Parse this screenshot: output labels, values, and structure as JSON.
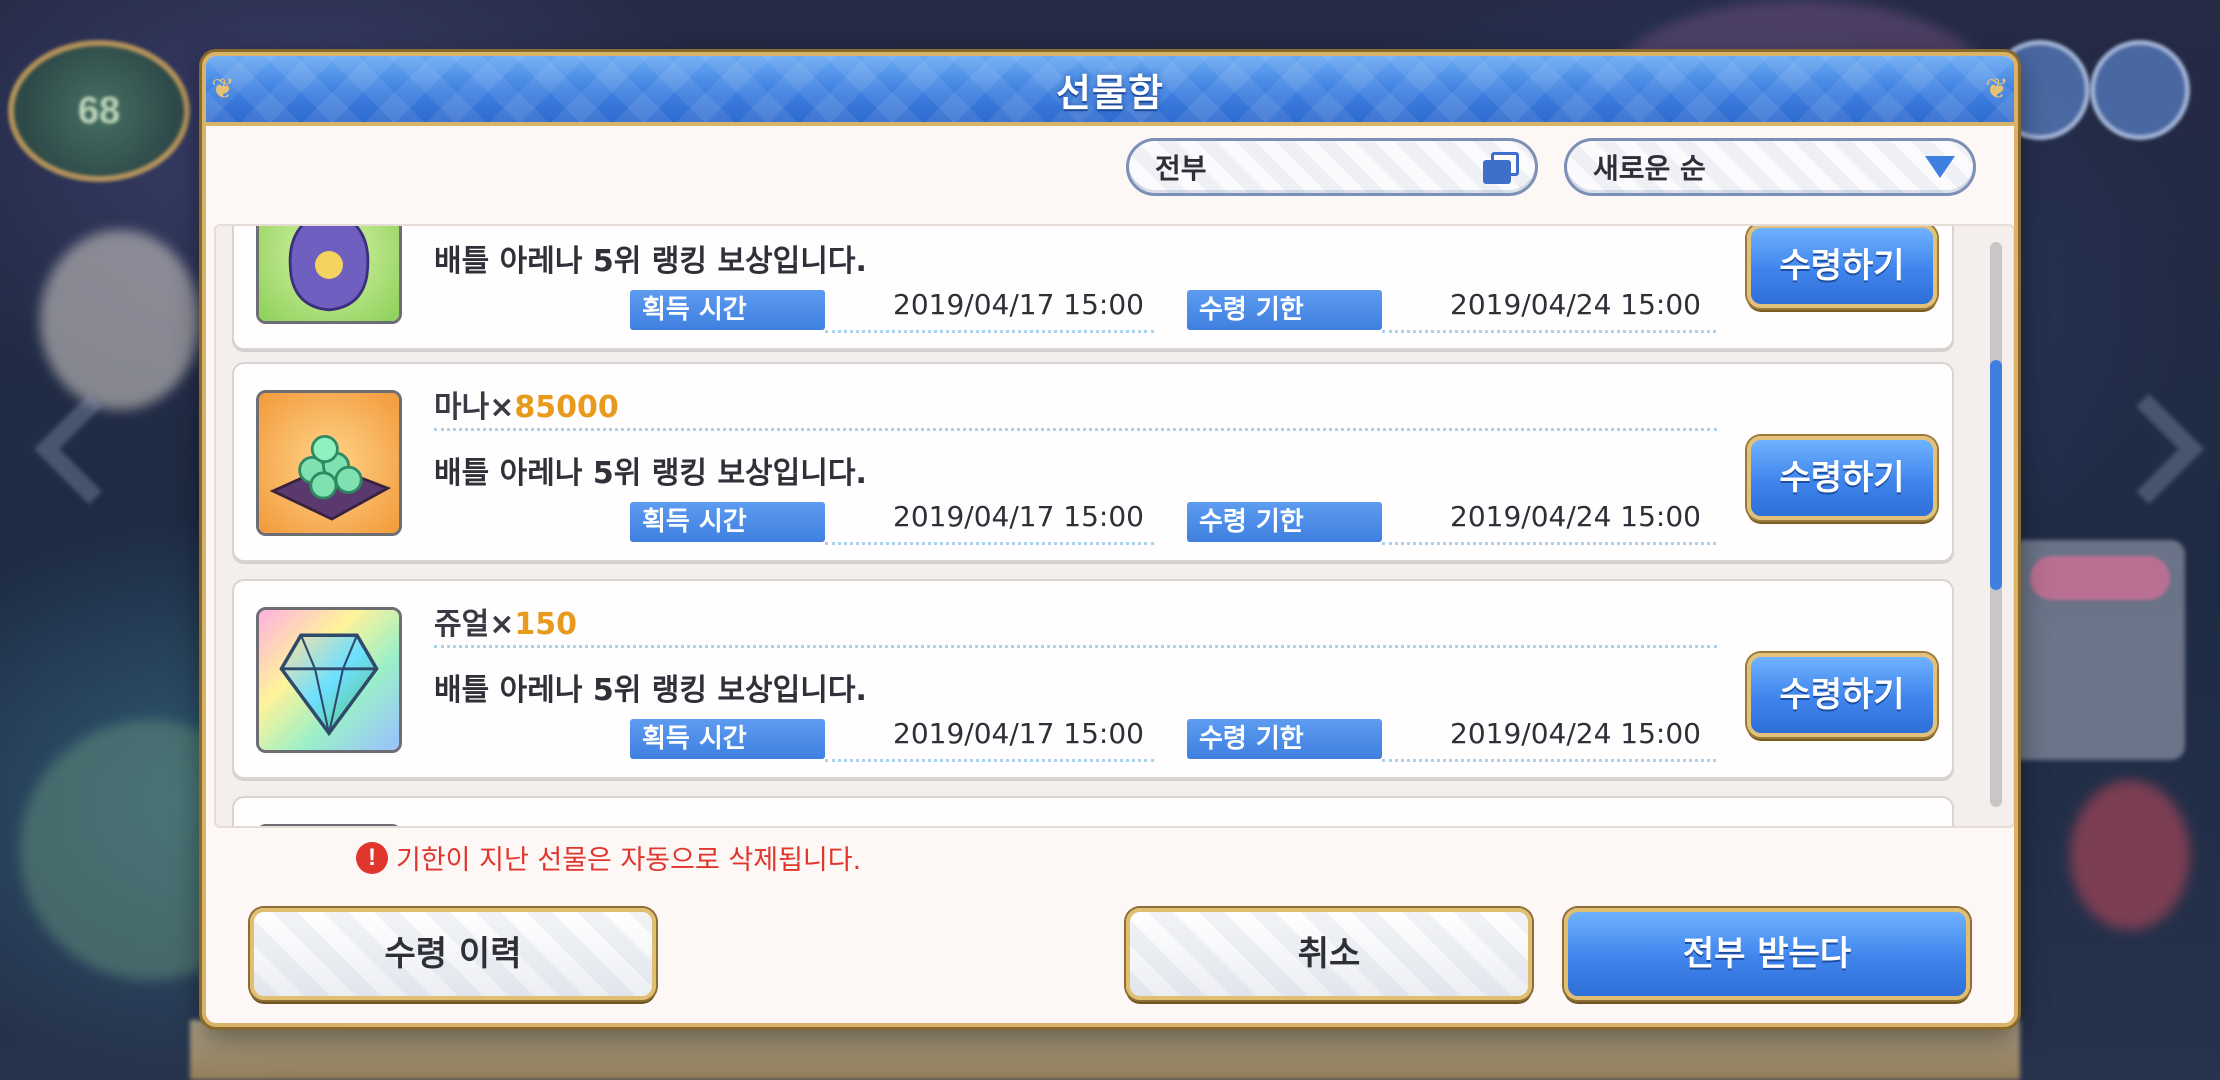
{
  "dialog": {
    "title": "선물함",
    "filter": {
      "selected": "전부",
      "icon": "copy-icon"
    },
    "sort": {
      "selected": "새로운 순",
      "icon": "dropdown-triangle-icon"
    }
  },
  "background": {
    "player_level": "68"
  },
  "colors": {
    "accent_blue": "#3f7fe0",
    "quantity_orange": "#e79a1e",
    "warning_red": "#e0362e",
    "gold_border": "#d9b468"
  },
  "gifts": [
    {
      "icon": "vase-icon",
      "name": "",
      "qty": "",
      "desc": "배틀 아레나 5위 랭킹 보상입니다.",
      "get_label": "획득 시간",
      "get_time": "2019/04/17 15:00",
      "exp_label": "수령 기한",
      "exp_time": "2019/04/24 15:00",
      "button": "수령하기"
    },
    {
      "icon": "mana-pile-icon",
      "name": "마나×",
      "qty": "85000",
      "desc": "배틀 아레나 5위 랭킹 보상입니다.",
      "get_label": "획득 시간",
      "get_time": "2019/04/17 15:00",
      "exp_label": "수령 기한",
      "exp_time": "2019/04/24 15:00",
      "button": "수령하기"
    },
    {
      "icon": "jewel-icon",
      "name": "쥬얼×",
      "qty": "150",
      "desc": "배틀 아레나 5위 랭킹 보상입니다.",
      "get_label": "획득 시간",
      "get_time": "2019/04/17 15:00",
      "exp_label": "수령 기한",
      "exp_time": "2019/04/24 15:00",
      "button": "수령하기"
    }
  ],
  "notice": "기한이 지난 선물은 자동으로 삭제됩니다.",
  "buttons": {
    "history": "수령 이력",
    "cancel": "취소",
    "receive_all": "전부 받는다"
  }
}
